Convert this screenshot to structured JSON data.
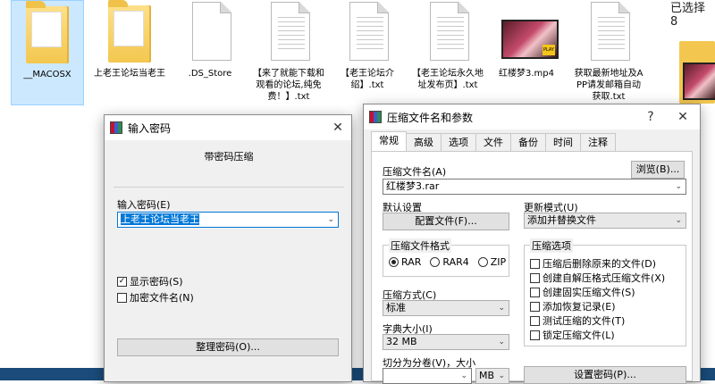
{
  "explorer": {
    "files": [
      {
        "name": "__MACOSX",
        "icon": "folder-icon",
        "selected": true
      },
      {
        "name": "上老王论坛当老王",
        "icon": "folder-icon"
      },
      {
        "name": ".DS_Store",
        "icon": "file-icon"
      },
      {
        "name": "【来了就能下载和观看的论坛,纯免费！】.txt",
        "icon": "text-file-icon"
      },
      {
        "name": "【老王论坛介绍】.txt",
        "icon": "text-file-icon"
      },
      {
        "name": "【老王论坛永久地址发布页】.txt",
        "icon": "text-file-icon"
      },
      {
        "name": "红楼梦3.mp4",
        "icon": "video-file-icon"
      },
      {
        "name": "获取最新地址及APP请发邮箱自动获取.txt",
        "icon": "text-file-icon"
      }
    ],
    "selection_text": "已选择 8"
  },
  "password_dialog": {
    "title": "输入密码",
    "heading": "带密码压缩",
    "input_label": "输入密码(E)",
    "password_value": "上老王论坛当老王",
    "show_password_label": "显示密码(S)",
    "show_password_checked": true,
    "encrypt_names_label": "加密文件名(N)",
    "encrypt_names_checked": false,
    "organize_button": "整理密码(O)..."
  },
  "archive_dialog": {
    "title": "压缩文件名和参数",
    "help": "?",
    "tabs": [
      "常规",
      "高级",
      "选项",
      "文件",
      "备份",
      "时间",
      "注释"
    ],
    "active_tab": 0,
    "archive_name_label": "压缩文件名(A)",
    "archive_name_value": "红楼梦3.rar",
    "browse_button": "浏览(B)...",
    "default_settings_label": "默认设置",
    "profiles_button": "配置文件(F)...",
    "update_mode_label": "更新模式(U)",
    "update_mode_value": "添加并替换文件",
    "format_group_label": "压缩文件格式",
    "formats": [
      "RAR",
      "RAR4",
      "ZIP"
    ],
    "selected_format": "RAR",
    "options_group_label": "压缩选项",
    "options": [
      {
        "label": "压缩后删除原来的文件(D)",
        "checked": false
      },
      {
        "label": "创建自解压格式压缩文件(X)",
        "checked": false
      },
      {
        "label": "创建固实压缩文件(S)",
        "checked": false
      },
      {
        "label": "添加恢复记录(E)",
        "checked": false
      },
      {
        "label": "测试压缩的文件(T)",
        "checked": false
      },
      {
        "label": "锁定压缩文件(L)",
        "checked": false
      }
    ],
    "method_label": "压缩方式(C)",
    "method_value": "标准",
    "dict_label": "字典大小(I)",
    "dict_value": "32 MB",
    "split_label": "切分为分卷(V)，大小",
    "split_unit": "MB",
    "set_password_button": "设置密码(P)..."
  }
}
